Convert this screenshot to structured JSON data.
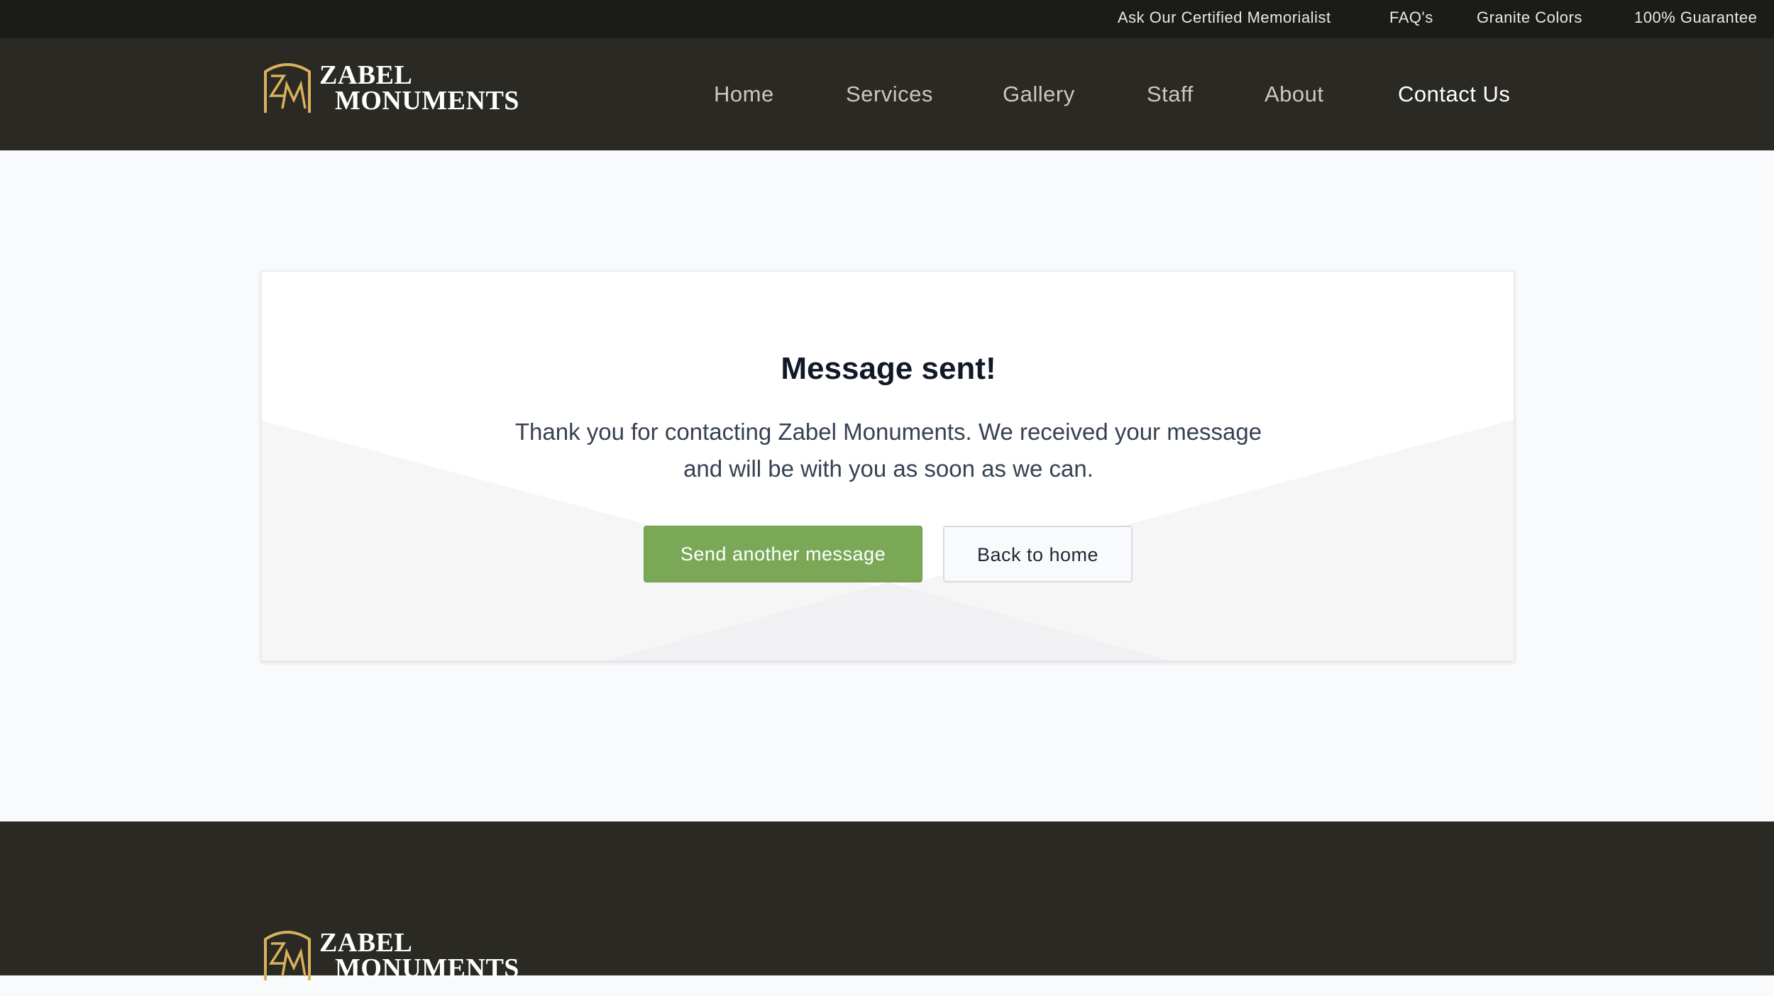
{
  "topbar": {
    "links": [
      {
        "label": "Ask Our Certified Memorialist"
      },
      {
        "label": "FAQ's"
      },
      {
        "label": "Granite Colors"
      },
      {
        "label": "100% Guarantee"
      }
    ]
  },
  "brand": {
    "monogram": "ZM",
    "name_line1": "ZABEL",
    "name_line2": "MONUMENTS",
    "gold": "#d9b15c"
  },
  "nav": {
    "items": [
      {
        "label": "Home"
      },
      {
        "label": "Services"
      },
      {
        "label": "Gallery"
      },
      {
        "label": "Staff"
      },
      {
        "label": "About"
      },
      {
        "label": "Contact Us",
        "active": true
      }
    ]
  },
  "confirmation": {
    "title": "Message sent!",
    "message": "Thank you for contacting Zabel Monuments. We received your message and will be with you as soon as we can.",
    "primary_button": "Send another message",
    "secondary_button": "Back to home"
  },
  "colors": {
    "topbar_bg": "#1b1b18",
    "header_bg": "#2a2924",
    "page_bg": "#f8fafc",
    "accent_green": "#7aa857"
  }
}
